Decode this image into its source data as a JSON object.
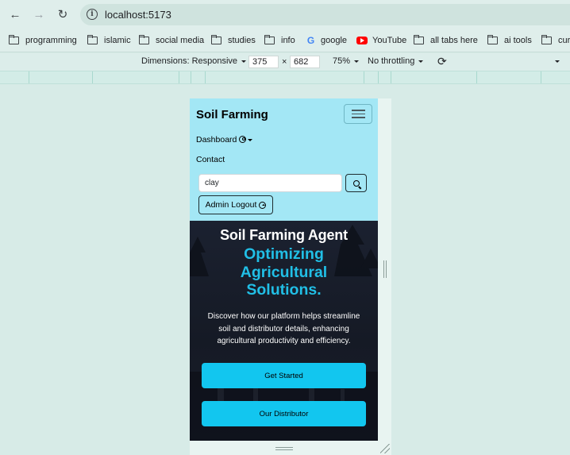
{
  "browser": {
    "url": "localhost:5173",
    "bookmarks": [
      {
        "label": "programming",
        "icon": "folder-icon"
      },
      {
        "label": "islamic",
        "icon": "folder-icon"
      },
      {
        "label": "social media",
        "icon": "folder-icon"
      },
      {
        "label": "studies",
        "icon": "folder-icon"
      },
      {
        "label": "info",
        "icon": "folder-icon"
      },
      {
        "label": "google",
        "icon": "google-icon"
      },
      {
        "label": "YouTube",
        "icon": "youtube-icon"
      },
      {
        "label": "all tabs here",
        "icon": "folder-icon"
      },
      {
        "label": "ai tools",
        "icon": "folder-icon"
      },
      {
        "label": "cur",
        "icon": "folder-icon"
      }
    ]
  },
  "devtools": {
    "dimensions_label": "Dimensions: Responsive",
    "width": "375",
    "times": "×",
    "height": "682",
    "zoom": "75%",
    "throttling": "No throttling"
  },
  "app": {
    "brand": "Soil Farming",
    "nav": {
      "dashboard": "Dashboard",
      "contact": "Contact"
    },
    "search": {
      "value": "clay"
    },
    "logout_label": "Admin Logout",
    "hero": {
      "title": "Soil Farming Agent",
      "subtitle_lines": [
        "Optimizing",
        "Agricultural",
        "Solutions."
      ],
      "description": "Discover how our platform helps streamline soil and distributor details, enhancing agricultural productivity and efficiency.",
      "cta_primary": "Get Started",
      "cta_secondary": "Our Distributor"
    }
  },
  "colors": {
    "navbar_bg": "#a3e7f5",
    "accent": "#21bfe6",
    "button": "#12c6ef",
    "hero_bg": "#161a25"
  }
}
